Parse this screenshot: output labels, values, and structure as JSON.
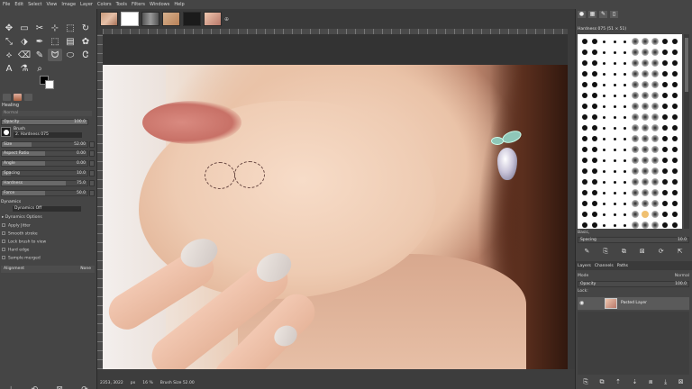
{
  "menu": [
    "File",
    "Edit",
    "Select",
    "View",
    "Image",
    "Layer",
    "Colors",
    "Tools",
    "Filters",
    "Windows",
    "Help"
  ],
  "tools": [
    "✥",
    "▭",
    "✂",
    "⊹",
    "⬚",
    "↻",
    "⤡",
    "⬗",
    "✒",
    "⬚",
    "▤",
    "✿",
    "⟡",
    "⌫",
    "✎",
    "ᗢ",
    "⬭",
    "Ꮳ",
    "A",
    "⚗",
    "⌕",
    "",
    "",
    ""
  ],
  "tool_options": {
    "title": "Healing",
    "mode_value": "Normal",
    "opacity": {
      "label": "Opacity",
      "value": "100.0",
      "fraction": 1.0
    },
    "brush_label": "Brush",
    "brush_name": "2. Hardness 075",
    "size": {
      "label": "Size",
      "value": "52.00",
      "fraction": 0.35
    },
    "aspect": {
      "label": "Aspect Ratio",
      "value": "0.00",
      "fraction": 0.5
    },
    "angle": {
      "label": "Angle",
      "value": "0.00",
      "fraction": 0.5
    },
    "spacing": {
      "label": "Spacing",
      "value": "10.0",
      "fraction": 0.1
    },
    "hardness": {
      "label": "Hardness",
      "value": "75.0",
      "fraction": 0.75
    },
    "force": {
      "label": "Force",
      "value": "50.0",
      "fraction": 0.5
    },
    "dynamics_label": "Dynamics",
    "dynamics_value": "Dynamics Off",
    "options": [
      "Dynamics Options",
      "Apply Jitter",
      "Smooth stroke",
      "Lock brush to view",
      "Hard edge",
      "Sample merged"
    ],
    "alignment_label": "Alignment",
    "alignment_value": "None"
  },
  "bottom_left_icons": [
    "⤓",
    "⟲",
    "⊠",
    "⟳"
  ],
  "image_tabs_add": "⊕",
  "statusbar": {
    "coords": "2353, 3022",
    "unit": "px",
    "zoom": "16 %",
    "message": "Brush Size 52.00"
  },
  "dock": {
    "brushes_header": "Hardness 075 (51 × 51)",
    "basic_label": "Basic,",
    "spacing": {
      "label": "Spacing",
      "value": "10.0"
    },
    "action_icons": [
      "✎",
      "⎘",
      "⧉",
      "⊠",
      "⟳",
      "⇱"
    ],
    "layer_tabs": [
      "Layers",
      "Channels",
      "Paths"
    ],
    "mode_label": "Mode",
    "mode_value": "Normal",
    "opacity": {
      "label": "Opacity",
      "value": "100.0"
    },
    "lock_label": "Lock:",
    "layer_name": "Pasted Layer",
    "bottom_icons": [
      "⎘",
      "⧉",
      "⇡",
      "⇣",
      "⧈",
      "⤓",
      "⊠"
    ]
  }
}
